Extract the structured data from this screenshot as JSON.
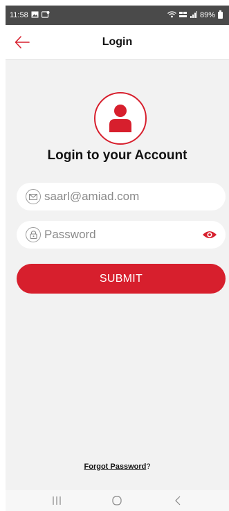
{
  "status_bar": {
    "time": "11:58",
    "left_icons": [
      "gallery-icon",
      "notification-icon"
    ],
    "right_icons": [
      "wifi-icon",
      "volte-icon",
      "signal-icon"
    ],
    "battery": "89%"
  },
  "app_bar": {
    "title": "Login",
    "back_icon": "arrow-left-icon"
  },
  "main": {
    "headline": "Login to your Account",
    "avatar_icon": "user-icon",
    "email": {
      "value": "",
      "placeholder": "saarl@amiad.com",
      "icon": "mail-icon"
    },
    "password": {
      "value": "",
      "placeholder": "Password",
      "icon": "lock-icon",
      "toggle_icon": "eye-icon"
    },
    "submit_label": "SUBMIT",
    "forgot_link": "Forgot Password",
    "forgot_suffix": "?"
  },
  "nav_bar": {
    "icons": [
      "recent-apps-icon",
      "home-icon",
      "back-icon"
    ]
  },
  "colors": {
    "accent": "#d71f2d",
    "background": "#f2f2f2",
    "status_bar": "#4a4a4a"
  }
}
